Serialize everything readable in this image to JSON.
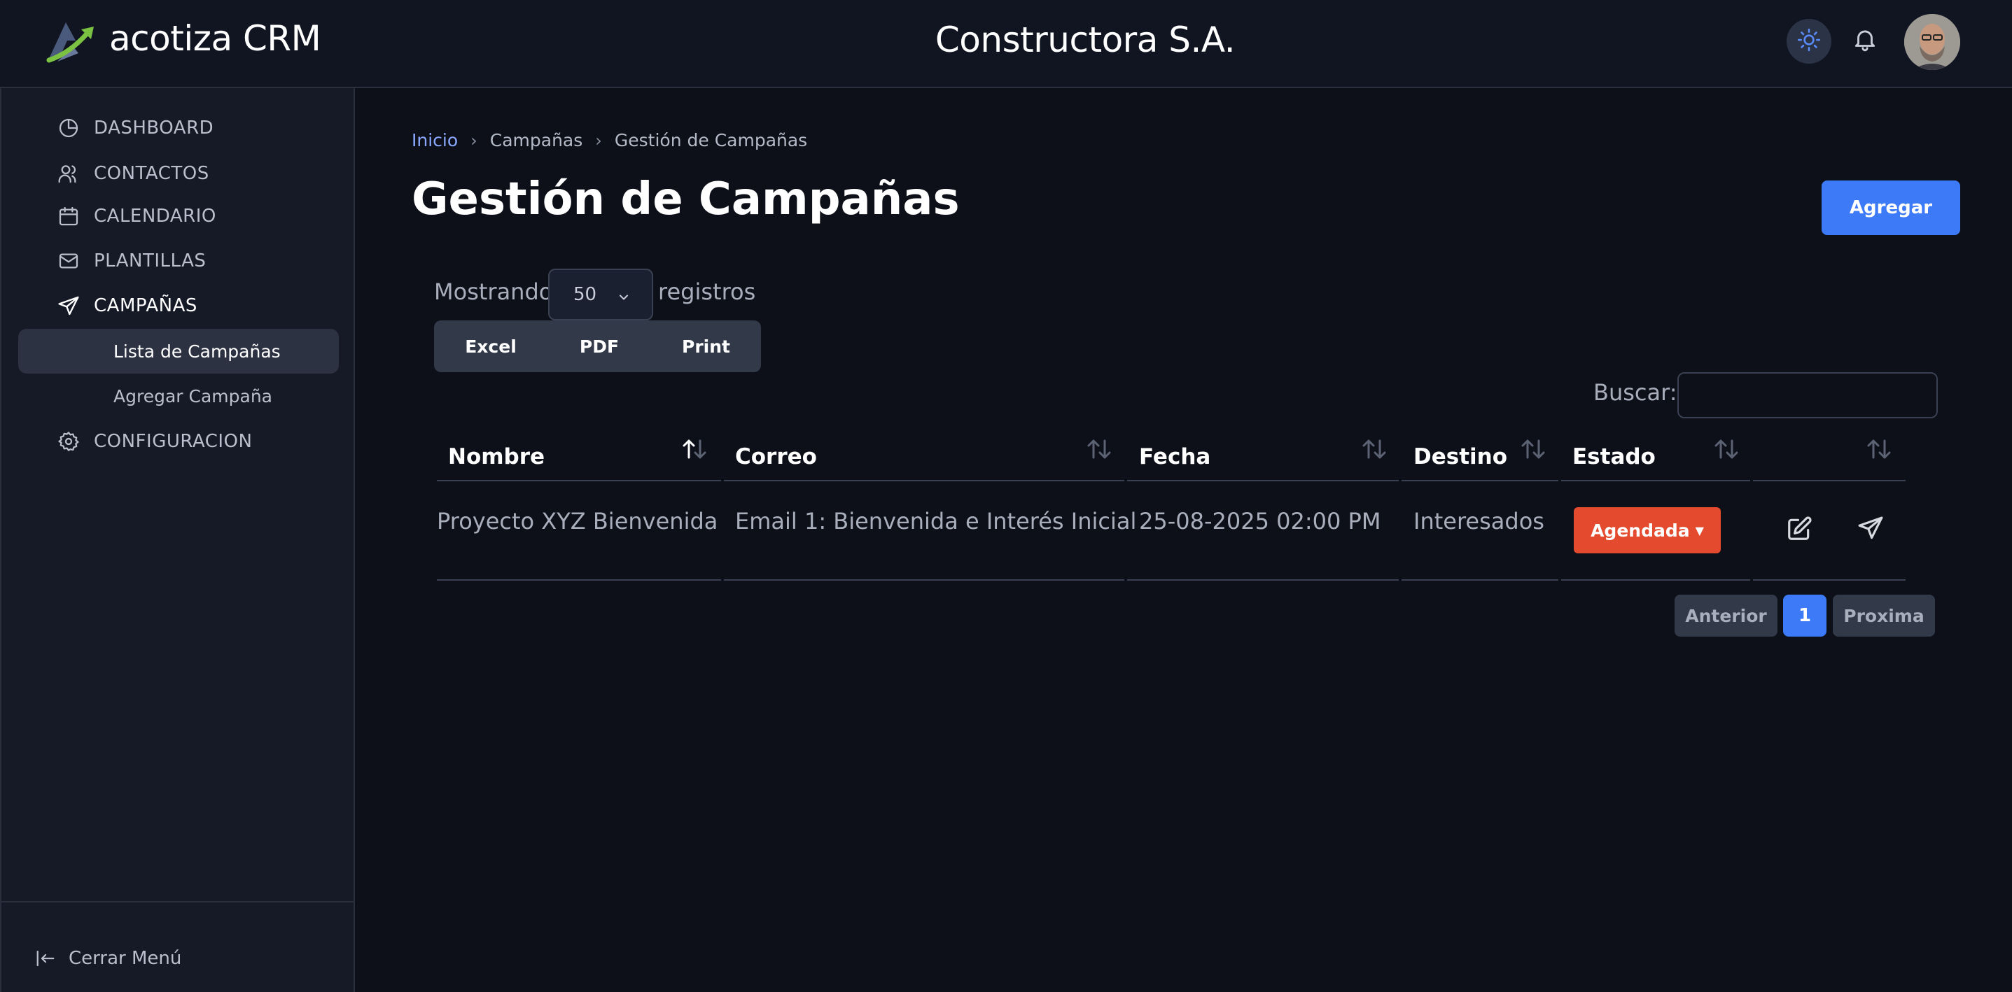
{
  "header": {
    "logo_text": "acotiza CRM",
    "company": "Constructora S.A.",
    "icons": {
      "theme": "sun-icon",
      "notifications": "bell-icon",
      "avatar": "user-avatar"
    }
  },
  "sidebar": {
    "items": [
      {
        "label": "DASHBOARD",
        "icon": "pie-chart-icon"
      },
      {
        "label": "CONTACTOS",
        "icon": "users-icon"
      },
      {
        "label": "CALENDARIO",
        "icon": "calendar-icon"
      },
      {
        "label": "PLANTILLAS",
        "icon": "mail-icon"
      },
      {
        "label": "CAMPAÑAS",
        "icon": "send-icon",
        "active": true
      },
      {
        "label": "CONFIGURACION",
        "icon": "gear-icon"
      }
    ],
    "subitems": [
      {
        "label": "Lista de Campañas",
        "active": true
      },
      {
        "label": "Agregar Campaña"
      }
    ],
    "collapse_label": "Cerrar Menú"
  },
  "breadcrumb": [
    "Inicio",
    "Campañas",
    "Gestión de Campañas"
  ],
  "page": {
    "title": "Gestión de Campañas",
    "add_label": "Agregar"
  },
  "table_controls": {
    "show_label": "Mostrando",
    "per_page": "50",
    "records_label": "registros",
    "export_buttons": [
      "Excel",
      "PDF",
      "Print"
    ],
    "search_label": "Buscar:",
    "search_value": ""
  },
  "table": {
    "headers": [
      "Nombre",
      "Correo",
      "Fecha",
      "Destino",
      "Estado",
      ""
    ],
    "rows": [
      {
        "nombre": "Proyecto XYZ Bienvenida",
        "correo": "Email 1: Bienvenida e Interés Inicial",
        "fecha": "25-08-2025 02:00 PM",
        "destino": "Interesados",
        "estado": "Agendada"
      }
    ]
  },
  "pagination": {
    "prev": "Anterior",
    "current": "1",
    "next": "Proxima"
  },
  "colors": {
    "accent": "#3d7af7",
    "status_agendada": "#e34a2e",
    "background": "#0e1019",
    "sidebar": "#161a27"
  }
}
